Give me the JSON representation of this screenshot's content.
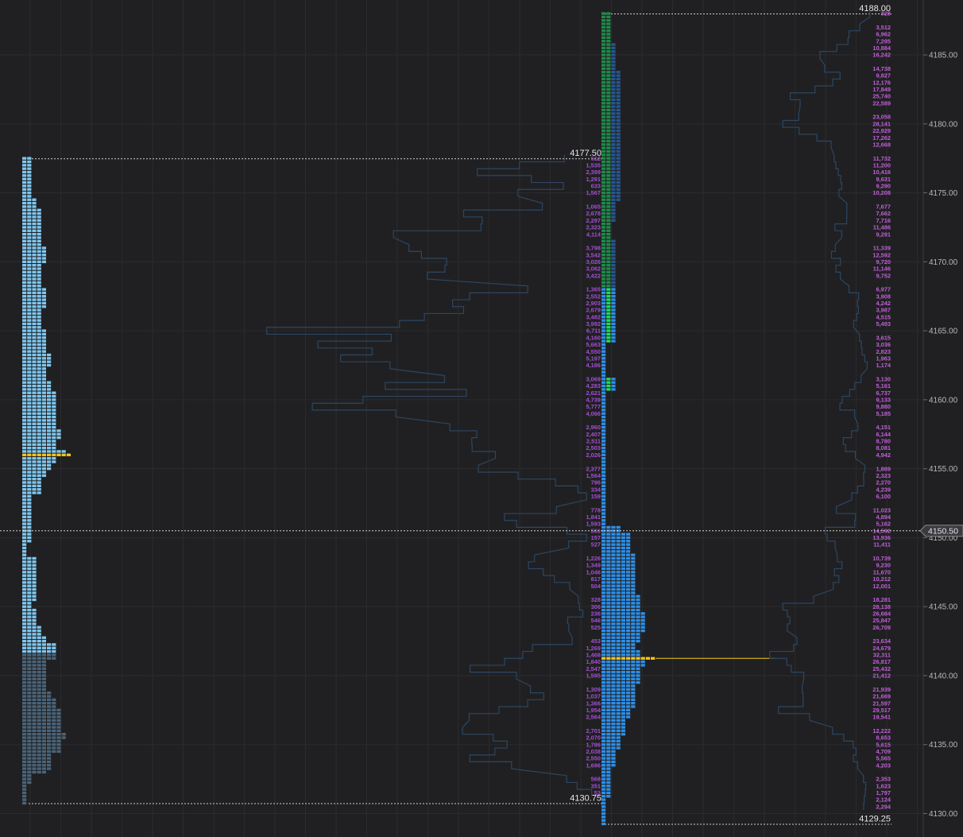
{
  "colors": {
    "background": "#202022",
    "grid": "#2b2b2e",
    "tpo_light": "#7fc7ef",
    "tpo_dark": "#4a6478",
    "tpo_blue": "#2e8fe6",
    "tpo_navy": "#26568f",
    "tpo_green_dark": "#1f8a4c",
    "tpo_green_bright": "#19e05f",
    "poc": "#f5c518",
    "outline": "#2c4663",
    "volume_text_left": "#a24fd0",
    "volume_text_right": "#c15fd8"
  },
  "chart_data": {
    "type": "market-profile",
    "y_axis": {
      "min": 4129.25,
      "max": 4188.0,
      "tick_step": 0.25,
      "ticks": [
        "4130.00",
        "4135.00",
        "4140.00",
        "4145.00",
        "4150.00",
        "4155.00",
        "4160.00",
        "4165.00",
        "4170.00",
        "4175.00",
        "4180.00",
        "4185.00"
      ]
    },
    "grid": true,
    "current_price": "4150.50",
    "left_profile": {
      "high_label": "4177.50",
      "low_label": "4130.75",
      "high": 4177.5,
      "low": 4130.75,
      "poc": 4156.0,
      "value_area_low": 4141.75,
      "widths": [
        [
          4177.5,
          2
        ],
        [
          4175.0,
          2
        ],
        [
          4174.5,
          3
        ],
        [
          4173.75,
          4
        ],
        [
          4172.0,
          4
        ],
        [
          4171.0,
          5
        ],
        [
          4169.75,
          4
        ],
        [
          4168.0,
          5
        ],
        [
          4166.5,
          4
        ],
        [
          4165.0,
          5
        ],
        [
          4163.25,
          6
        ],
        [
          4162.25,
          5
        ],
        [
          4161.25,
          6
        ],
        [
          4160.5,
          7
        ],
        [
          4159.0,
          7
        ],
        [
          4157.75,
          8
        ],
        [
          4157.0,
          7
        ],
        [
          4156.25,
          9
        ],
        [
          4155.75,
          7
        ],
        [
          4155.25,
          6
        ],
        [
          4154.75,
          5
        ],
        [
          4154.25,
          4
        ],
        [
          4153.0,
          2
        ],
        [
          4151.75,
          2
        ],
        [
          4149.75,
          2
        ],
        [
          4149.5,
          1
        ],
        [
          4148.5,
          3
        ],
        [
          4146.25,
          3
        ],
        [
          4145.25,
          2
        ],
        [
          4144.75,
          3
        ],
        [
          4143.5,
          4
        ],
        [
          4142.75,
          5
        ],
        [
          4142.25,
          7
        ],
        [
          4141.75,
          7
        ],
        [
          4141.0,
          5
        ],
        [
          4140.0,
          5
        ],
        [
          4138.75,
          6
        ],
        [
          4138.25,
          7
        ],
        [
          4137.5,
          8
        ],
        [
          4136.25,
          8
        ],
        [
          4135.75,
          9
        ],
        [
          4135.25,
          8
        ],
        [
          4134.25,
          6
        ],
        [
          4133.0,
          5
        ],
        [
          4132.75,
          2
        ],
        [
          4132.0,
          1
        ],
        [
          4130.75,
          1
        ]
      ],
      "volumes": [
        [
          4177.5,
          "612"
        ],
        [
          4177.0,
          "1,535"
        ],
        [
          4176.5,
          "2,399"
        ],
        [
          4176.0,
          "1,291"
        ],
        [
          4175.5,
          "633"
        ],
        [
          4175.0,
          "1,567"
        ],
        [
          4174.0,
          "1,065"
        ],
        [
          4173.5,
          "2,678"
        ],
        [
          4173.0,
          "2,297"
        ],
        [
          4172.5,
          "2,323"
        ],
        [
          4172.0,
          "4,114"
        ],
        [
          4171.0,
          "3,798"
        ],
        [
          4170.5,
          "3,542"
        ],
        [
          4170.0,
          "3,026"
        ],
        [
          4169.5,
          "3,062"
        ],
        [
          4169.0,
          "3,422"
        ],
        [
          4168.0,
          "1,365"
        ],
        [
          4167.5,
          "2,552"
        ],
        [
          4167.0,
          "2,903"
        ],
        [
          4166.5,
          "2,679"
        ],
        [
          4166.0,
          "3,482"
        ],
        [
          4165.5,
          "3,992"
        ],
        [
          4165.0,
          "6,711"
        ],
        [
          4164.5,
          "4,160"
        ],
        [
          4164.0,
          "5,663"
        ],
        [
          4163.5,
          "4,550"
        ],
        [
          4163.0,
          "5,197"
        ],
        [
          4162.5,
          "4,186"
        ],
        [
          4161.5,
          "3,069"
        ],
        [
          4161.0,
          "4,283"
        ],
        [
          4160.5,
          "2,621"
        ],
        [
          4160.0,
          "4,739"
        ],
        [
          4159.5,
          "5,777"
        ],
        [
          4159.0,
          "4,066"
        ],
        [
          4158.0,
          "2,960"
        ],
        [
          4157.5,
          "2,407"
        ],
        [
          4157.0,
          "2,511"
        ],
        [
          4156.5,
          "2,503"
        ],
        [
          4156.0,
          "2,026"
        ],
        [
          4155.0,
          "2,377"
        ],
        [
          4154.5,
          "1,564"
        ],
        [
          4154.0,
          "796"
        ],
        [
          4153.5,
          "334"
        ],
        [
          4153.0,
          "159"
        ],
        [
          4152.0,
          "778"
        ],
        [
          4151.5,
          "1,841"
        ],
        [
          4151.0,
          "1,593"
        ],
        [
          4150.5,
          "561"
        ],
        [
          4150.0,
          "157"
        ],
        [
          4149.5,
          "527"
        ],
        [
          4148.5,
          "1,226"
        ],
        [
          4148.0,
          "1,349"
        ],
        [
          4147.5,
          "1,046"
        ],
        [
          4147.0,
          "817"
        ],
        [
          4146.5,
          "504"
        ],
        [
          4145.5,
          "328"
        ],
        [
          4145.0,
          "306"
        ],
        [
          4144.5,
          "236"
        ],
        [
          4144.0,
          "546"
        ],
        [
          4143.5,
          "525"
        ],
        [
          4142.5,
          "453"
        ],
        [
          4142.0,
          "1,269"
        ],
        [
          4141.5,
          "1,468"
        ],
        [
          4141.0,
          "1,840"
        ],
        [
          4140.5,
          "2,547"
        ],
        [
          4140.0,
          "1,595"
        ],
        [
          4139.0,
          "1,309"
        ],
        [
          4138.5,
          "1,037"
        ],
        [
          4138.0,
          "1,366"
        ],
        [
          4137.5,
          "1,954"
        ],
        [
          4137.0,
          "2,564"
        ],
        [
          4136.0,
          "2,701"
        ],
        [
          4135.5,
          "2,070"
        ],
        [
          4135.0,
          "1,786"
        ],
        [
          4134.5,
          "2,038"
        ],
        [
          4134.0,
          "2,550"
        ],
        [
          4133.5,
          "1,696"
        ],
        [
          4132.5,
          "568"
        ],
        [
          4132.0,
          "351"
        ],
        [
          4131.5,
          "53"
        ]
      ]
    },
    "right_profile": {
      "high_label": "4188.00",
      "low_label": "4129.25",
      "high": 4188.0,
      "low": 4129.25,
      "poc": 4141.25,
      "widths": [
        [
          4188.0,
          2
        ],
        [
          4185.75,
          3
        ],
        [
          4183.75,
          4
        ],
        [
          4179.5,
          4
        ],
        [
          4175.5,
          4
        ],
        [
          4174.25,
          3
        ],
        [
          4172.75,
          2
        ],
        [
          4171.5,
          3
        ],
        [
          4169.0,
          3
        ],
        [
          4168.5,
          3
        ],
        [
          4167.0,
          3
        ],
        [
          4164.0,
          1
        ],
        [
          4162.75,
          1
        ],
        [
          4161.5,
          3
        ],
        [
          4160.75,
          3
        ],
        [
          4160.5,
          1
        ],
        [
          4150.75,
          4
        ],
        [
          4150.25,
          6
        ],
        [
          4148.75,
          7
        ],
        [
          4147.5,
          7
        ],
        [
          4146.0,
          7
        ],
        [
          4145.75,
          8
        ],
        [
          4144.5,
          9
        ],
        [
          4143.0,
          8
        ],
        [
          4142.25,
          7
        ],
        [
          4141.75,
          8
        ],
        [
          4141.25,
          9
        ],
        [
          4140.5,
          8
        ],
        [
          4139.25,
          7
        ],
        [
          4137.5,
          6
        ],
        [
          4136.75,
          5
        ],
        [
          4135.5,
          4
        ],
        [
          4134.5,
          3
        ],
        [
          4133.25,
          2
        ],
        [
          4132.5,
          2
        ],
        [
          4131.0,
          1
        ],
        [
          4129.25,
          1
        ]
      ],
      "green_light_range": [
        4160.5,
        4168.0
      ],
      "volumes": [
        [
          4188.0,
          "328"
        ],
        [
          4187.0,
          "3,512"
        ],
        [
          4186.5,
          "6,962"
        ],
        [
          4186.0,
          "7,295"
        ],
        [
          4185.5,
          "10,884"
        ],
        [
          4185.0,
          "16,242"
        ],
        [
          4184.0,
          "14,738"
        ],
        [
          4183.5,
          "9,827"
        ],
        [
          4183.0,
          "12,176"
        ],
        [
          4182.5,
          "17,849"
        ],
        [
          4182.0,
          "25,740"
        ],
        [
          4181.5,
          "22,589"
        ],
        [
          4180.5,
          "23,058"
        ],
        [
          4180.0,
          "28,141"
        ],
        [
          4179.5,
          "22,929"
        ],
        [
          4179.0,
          "17,262"
        ],
        [
          4178.5,
          "12,668"
        ],
        [
          4177.5,
          "11,732"
        ],
        [
          4177.0,
          "11,200"
        ],
        [
          4176.5,
          "10,416"
        ],
        [
          4176.0,
          "9,631"
        ],
        [
          4175.5,
          "9,290"
        ],
        [
          4175.0,
          "10,208"
        ],
        [
          4174.0,
          "7,677"
        ],
        [
          4173.5,
          "7,662"
        ],
        [
          4173.0,
          "7,716"
        ],
        [
          4172.5,
          "11,486"
        ],
        [
          4172.0,
          "9,291"
        ],
        [
          4171.0,
          "11,339"
        ],
        [
          4170.5,
          "12,592"
        ],
        [
          4170.0,
          "9,720"
        ],
        [
          4169.5,
          "11,146"
        ],
        [
          4169.0,
          "9,752"
        ],
        [
          4168.0,
          "6,977"
        ],
        [
          4167.5,
          "3,908"
        ],
        [
          4167.0,
          "4,242"
        ],
        [
          4166.5,
          "3,987"
        ],
        [
          4166.0,
          "4,515"
        ],
        [
          4165.5,
          "5,493"
        ],
        [
          4164.5,
          "3,615"
        ],
        [
          4164.0,
          "3,036"
        ],
        [
          4163.5,
          "2,823"
        ],
        [
          4163.0,
          "1,963"
        ],
        [
          4162.5,
          "1,174"
        ],
        [
          4161.5,
          "3,130"
        ],
        [
          4161.0,
          "5,161"
        ],
        [
          4160.5,
          "6,737"
        ],
        [
          4160.0,
          "9,133"
        ],
        [
          4159.5,
          "9,880"
        ],
        [
          4159.0,
          "5,185"
        ],
        [
          4158.0,
          "4,151"
        ],
        [
          4157.5,
          "6,144"
        ],
        [
          4157.0,
          "8,780"
        ],
        [
          4156.5,
          "8,081"
        ],
        [
          4156.0,
          "4,942"
        ],
        [
          4155.0,
          "1,889"
        ],
        [
          4154.5,
          "2,323"
        ],
        [
          4154.0,
          "2,270"
        ],
        [
          4153.5,
          "4,239"
        ],
        [
          4153.0,
          "6,100"
        ],
        [
          4152.0,
          "11,023"
        ],
        [
          4151.5,
          "4,894"
        ],
        [
          4151.0,
          "5,162"
        ],
        [
          4150.5,
          "14,592"
        ],
        [
          4150.0,
          "13,936"
        ],
        [
          4149.5,
          "11,411"
        ],
        [
          4148.5,
          "10,739"
        ],
        [
          4148.0,
          "9,230"
        ],
        [
          4147.5,
          "11,670"
        ],
        [
          4147.0,
          "10,212"
        ],
        [
          4146.5,
          "12,001"
        ],
        [
          4145.5,
          "18,281"
        ],
        [
          4145.0,
          "28,138"
        ],
        [
          4144.5,
          "26,684"
        ],
        [
          4144.0,
          "25,847"
        ],
        [
          4143.5,
          "26,709"
        ],
        [
          4142.5,
          "23,634"
        ],
        [
          4142.0,
          "24,679"
        ],
        [
          4141.5,
          "32,311"
        ],
        [
          4141.0,
          "26,817"
        ],
        [
          4140.5,
          "25,432"
        ],
        [
          4140.0,
          "21,412"
        ],
        [
          4139.0,
          "21,939"
        ],
        [
          4138.5,
          "21,669"
        ],
        [
          4138.0,
          "21,597"
        ],
        [
          4137.5,
          "29,517"
        ],
        [
          4137.0,
          "19,541"
        ],
        [
          4136.0,
          "12,222"
        ],
        [
          4135.5,
          "8,653"
        ],
        [
          4135.0,
          "5,615"
        ],
        [
          4134.5,
          "4,709"
        ],
        [
          4134.0,
          "5,565"
        ],
        [
          4133.5,
          "4,203"
        ],
        [
          4132.5,
          "2,353"
        ],
        [
          4132.0,
          "1,623"
        ],
        [
          4131.5,
          "1,797"
        ],
        [
          4131.0,
          "2,124"
        ],
        [
          4130.5,
          "2,294"
        ]
      ]
    }
  }
}
